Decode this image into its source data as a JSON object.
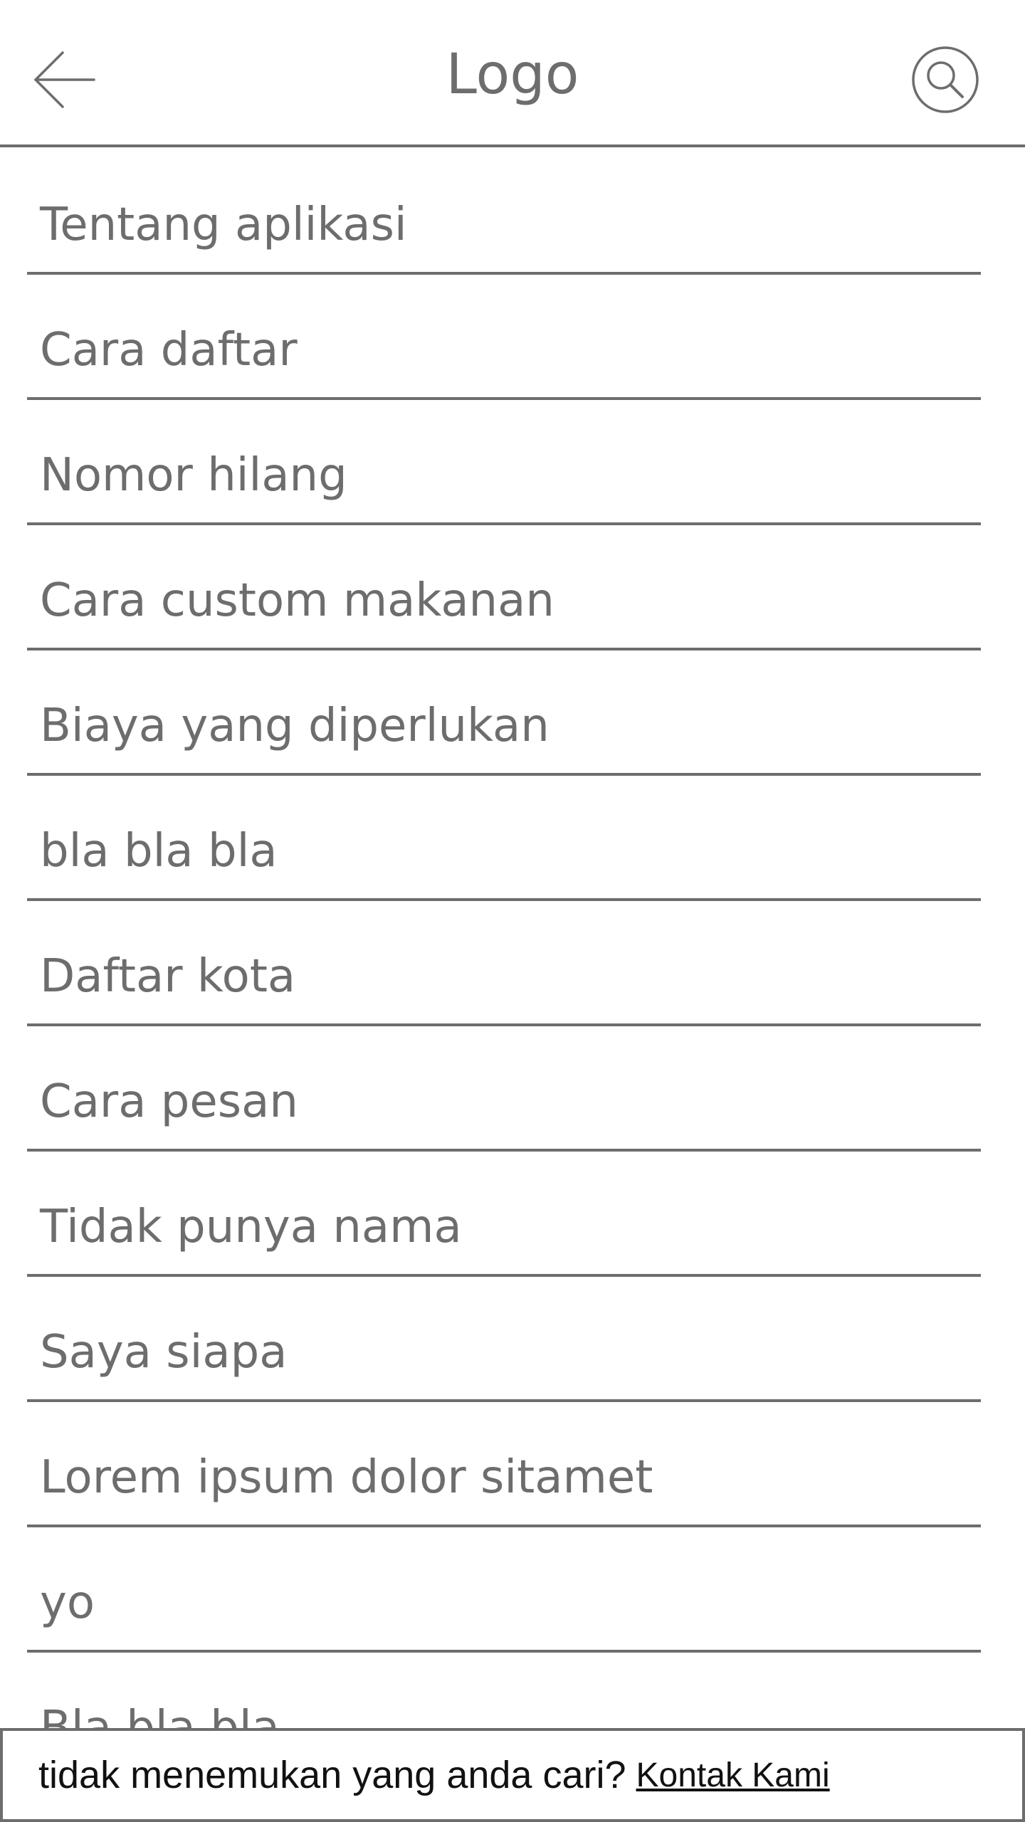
{
  "header": {
    "title": "Logo",
    "back_icon": "arrow-left-icon",
    "search_icon": "search-icon"
  },
  "faq": {
    "items": [
      {
        "label": "Tentang aplikasi"
      },
      {
        "label": "Cara daftar"
      },
      {
        "label": "Nomor hilang"
      },
      {
        "label": "Cara custom makanan"
      },
      {
        "label": "Biaya yang diperlukan"
      },
      {
        "label": "bla bla bla"
      },
      {
        "label": "Daftar kota"
      },
      {
        "label": "Cara pesan"
      },
      {
        "label": "Tidak punya nama"
      },
      {
        "label": "Saya siapa"
      },
      {
        "label": "Lorem ipsum dolor sitamet"
      },
      {
        "label": "yo"
      },
      {
        "label": "Bla bla bla"
      }
    ]
  },
  "footer": {
    "prompt": "tidak menemukan yang anda cari?",
    "link_label": "Kontak Kami"
  },
  "colors": {
    "text_gray": "#6d6d6d",
    "line_gray": "#6d6d6d",
    "footer_text": "#111111",
    "background": "#ffffff"
  }
}
